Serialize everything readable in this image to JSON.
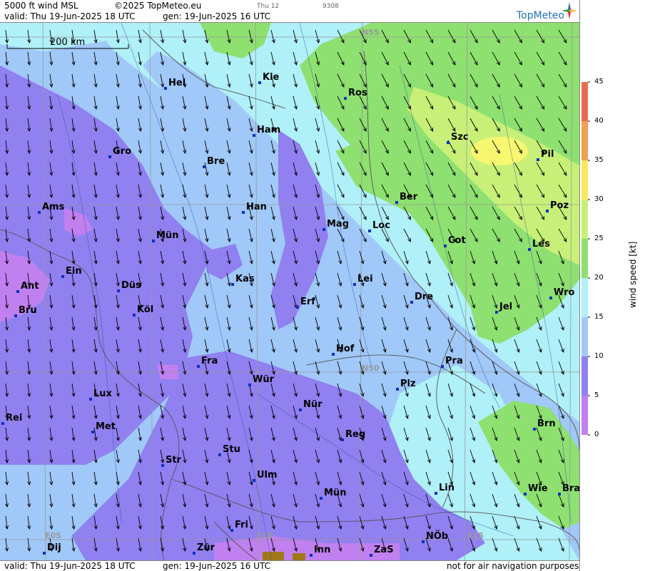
{
  "header": {
    "title": "5000 ft wind MSL",
    "copyright": "©2025 TopMeteo.eu",
    "valid": "valid:  Thu  19-Jun-2025  18 UTC",
    "gen": "gen: 19-Jun-2025 16 UTC",
    "small_day": "Thu 12",
    "small_code": "9308",
    "logo": "TopMeteo"
  },
  "footer": {
    "valid": "valid:  Thu  19-Jun-2025  18 UTC",
    "gen": "gen: 19-Jun-2025 16 UTC",
    "disclaimer": "not for air navigation purposes"
  },
  "scale_bar": {
    "label": "200 km"
  },
  "legend": {
    "title": "wind speed  [kt]",
    "ticks": [
      "45",
      "40",
      "35",
      "30",
      "25",
      "20",
      "15",
      "10",
      "5",
      "0"
    ],
    "colors": [
      "#e86d50",
      "#f0a050",
      "#f5d060",
      "#f8f870",
      "#c8f078",
      "#8ee070",
      "#b0f0f8",
      "#a0c8f8",
      "#9080f0",
      "#c080f0"
    ]
  },
  "grid_labels": {
    "n55": "N55",
    "n50": "N50",
    "e05": "E05",
    "e10": "E10",
    "e15": "E15"
  },
  "cities": [
    {
      "name": "Kie"
    },
    {
      "name": "Hel"
    },
    {
      "name": "Ros"
    },
    {
      "name": "Ham"
    },
    {
      "name": "Szc"
    },
    {
      "name": "Gro"
    },
    {
      "name": "Bre"
    },
    {
      "name": "Pil"
    },
    {
      "name": "Ber"
    },
    {
      "name": "Ams"
    },
    {
      "name": "Han"
    },
    {
      "name": "Poz"
    },
    {
      "name": "Mag"
    },
    {
      "name": "Loc"
    },
    {
      "name": "Mün"
    },
    {
      "name": "Cot"
    },
    {
      "name": "Les"
    },
    {
      "name": "Ein"
    },
    {
      "name": "Kas"
    },
    {
      "name": "Lei"
    },
    {
      "name": "Ant"
    },
    {
      "name": "Düs"
    },
    {
      "name": "Wro"
    },
    {
      "name": "Dre"
    },
    {
      "name": "Erf"
    },
    {
      "name": "Bru"
    },
    {
      "name": "Köl"
    },
    {
      "name": "Jel"
    },
    {
      "name": "Hof"
    },
    {
      "name": "Fra"
    },
    {
      "name": "Pra"
    },
    {
      "name": "Wür"
    },
    {
      "name": "Plz"
    },
    {
      "name": "Lux"
    },
    {
      "name": "Nür"
    },
    {
      "name": "Rei"
    },
    {
      "name": "Met"
    },
    {
      "name": "Reg"
    },
    {
      "name": "Brn"
    },
    {
      "name": "Stu"
    },
    {
      "name": "Str"
    },
    {
      "name": "Ulm"
    },
    {
      "name": "Lin"
    },
    {
      "name": "Mün"
    },
    {
      "name": "Wie"
    },
    {
      "name": "Bra"
    },
    {
      "name": "Fri"
    },
    {
      "name": "NÖb"
    },
    {
      "name": "Dij"
    },
    {
      "name": "Zür"
    },
    {
      "name": "Inn"
    },
    {
      "name": "ZaS"
    }
  ]
}
